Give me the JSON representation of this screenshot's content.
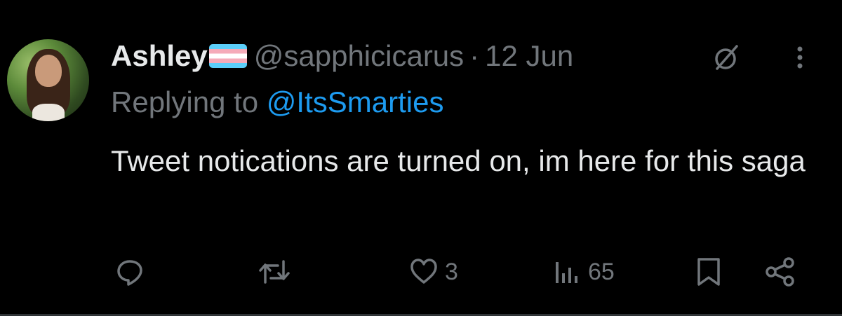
{
  "author": {
    "name": "Ashley",
    "flag": "transgender-flag-emoji",
    "handle": "@sapphicicarus",
    "separator": "·",
    "date": "12 Jun"
  },
  "reply": {
    "prefix": "Replying to",
    "mention": "@ItsSmarties"
  },
  "tweet": {
    "text": "Tweet notications are turned on, im here for this saga"
  },
  "actions": {
    "likes": "3",
    "views": "65"
  },
  "colors": {
    "background": "#000000",
    "text": "#e7e9ea",
    "muted": "#71767b",
    "link": "#1d9bf0"
  }
}
